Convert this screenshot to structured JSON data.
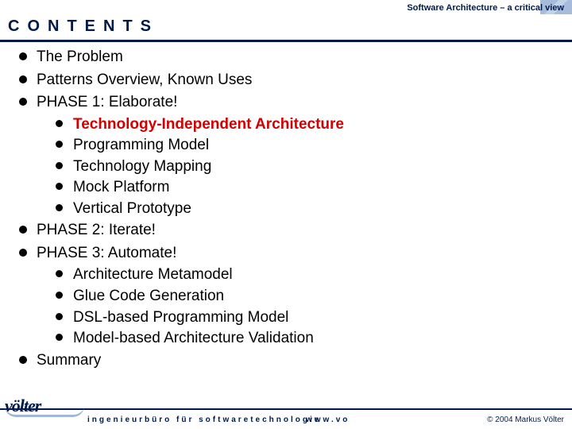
{
  "header": {
    "tagline": "Software Architecture – a critical view"
  },
  "title": "CONTENTS",
  "outline": [
    {
      "text": "The Problem"
    },
    {
      "text": "Patterns Overview, Known Uses"
    },
    {
      "text": "PHASE 1: Elaborate!",
      "children": [
        {
          "text": "Technology-Independent Architecture",
          "highlight": true
        },
        {
          "text": "Programming Model"
        },
        {
          "text": "Technology Mapping"
        },
        {
          "text": "Mock Platform"
        },
        {
          "text": "Vertical Prototype"
        }
      ]
    },
    {
      "text": "PHASE 2: Iterate!"
    },
    {
      "text": "PHASE 3: Automate!",
      "children": [
        {
          "text": "Architecture Metamodel"
        },
        {
          "text": "Glue Code Generation"
        },
        {
          "text": "DSL-based Programming Model"
        },
        {
          "text": "Model-based Architecture Validation"
        }
      ]
    },
    {
      "text": "Summary"
    }
  ],
  "footer": {
    "logo_text": "völter",
    "tagline": "ingenieurbüro für softwaretechnologie",
    "website": "www.vo",
    "copyright": "© 2004  Markus Völter"
  }
}
